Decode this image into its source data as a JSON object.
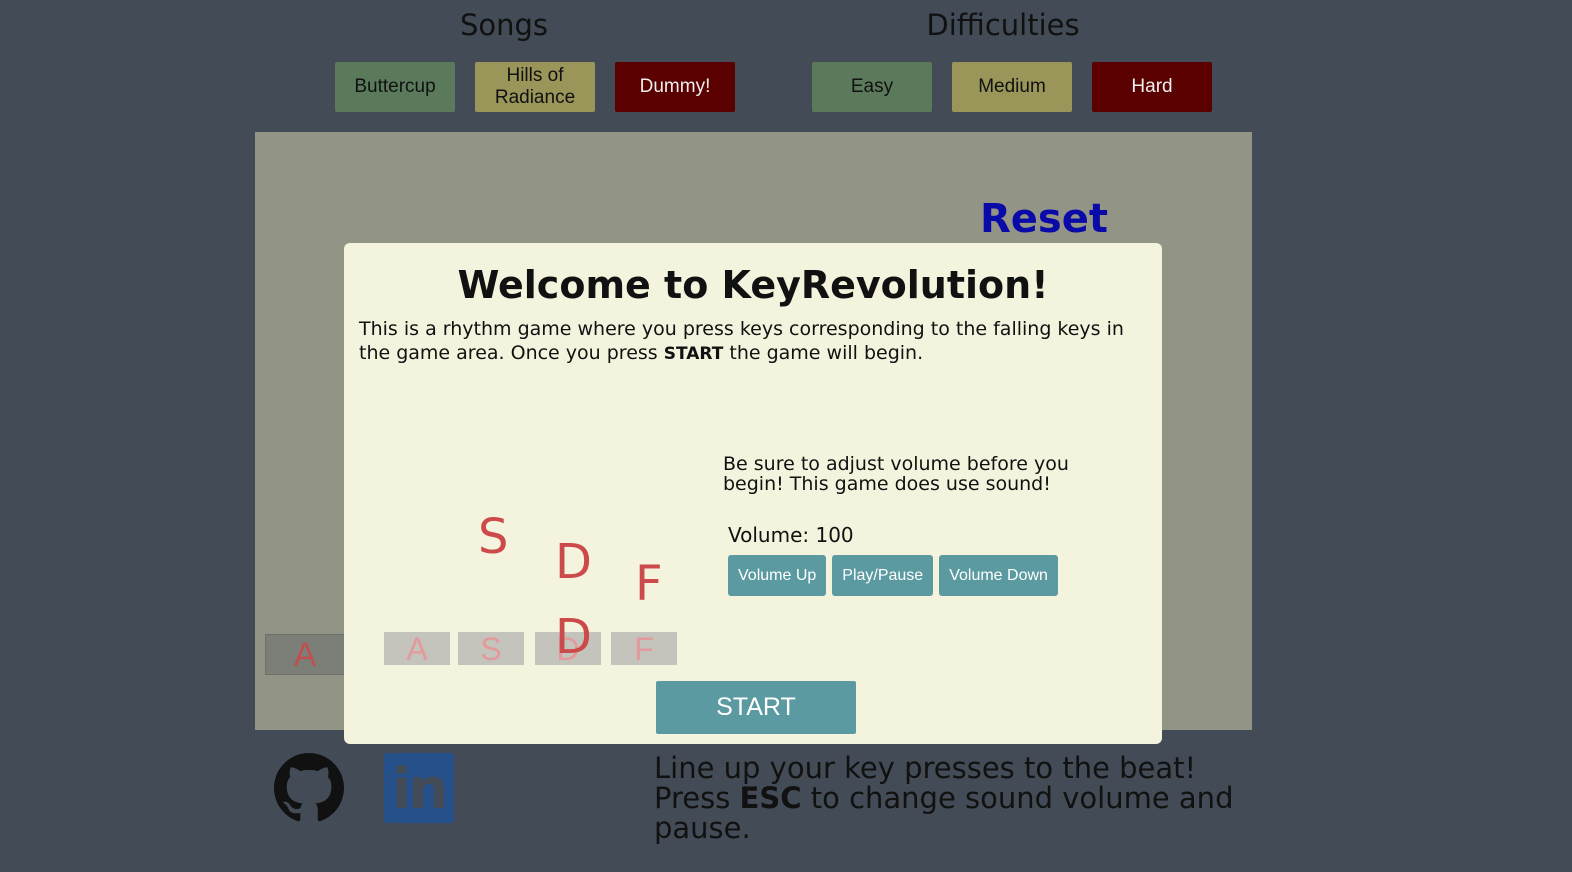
{
  "songs": {
    "heading": "Songs",
    "buttons": [
      "Buttercup",
      "Hills of Radiance",
      "Dummy!"
    ]
  },
  "difficulties": {
    "heading": "Difficulties",
    "buttons": [
      "Easy",
      "Medium",
      "Hard"
    ]
  },
  "game": {
    "reset_label": "Reset",
    "outer_slot_key": "A"
  },
  "modal": {
    "title": "Welcome to KeyRevolution!",
    "desc_part1": "This is a rhythm game where you press keys corresponding to the falling keys in the game area. Once you press ",
    "desc_bold": "START",
    "desc_part2": " the game will begin.",
    "falling_keys": [
      "S",
      "D",
      "F",
      "D"
    ],
    "slot_keys": [
      "A",
      "S",
      "D",
      "F"
    ],
    "volume_note": "Be sure to adjust volume before you begin! This game does use sound!",
    "volume_label": "Volume: 100",
    "volume_buttons": [
      "Volume Up",
      "Play/Pause",
      "Volume Down"
    ],
    "start_label": "START"
  },
  "footer": {
    "line1": "Line up your key presses to the beat!",
    "line2_pre": "Press ",
    "line2_bold": "ESC",
    "line2_post": " to change sound volume and pause.",
    "icons": [
      "github-icon",
      "linkedin-icon"
    ],
    "linkedin_text": "in"
  },
  "colors": {
    "background": "#434c56",
    "game_area": "#929485",
    "modal": "#f4f3dd",
    "accent_teal": "#5a9aa0",
    "reset_blue": "#0a0aa8",
    "key_red": "#cd4a4a"
  }
}
